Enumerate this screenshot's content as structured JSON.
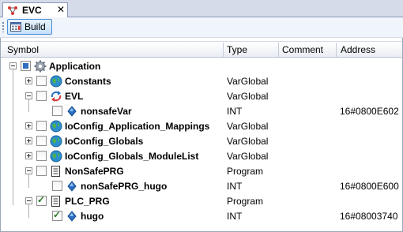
{
  "tab": {
    "title": "EVC",
    "close": "✕",
    "icon": "evc-icon"
  },
  "toolbar": {
    "build_label": "Build",
    "build_icon": "build-icon"
  },
  "columns": {
    "symbol": "Symbol",
    "type": "Type",
    "comment": "Comment",
    "address": "Address"
  },
  "rows": [
    {
      "name": "Application",
      "type": "",
      "address": "",
      "icon": "gear-icon",
      "checkbox": "partial",
      "expander": "minus"
    },
    {
      "name": "Constants",
      "type": "VarGlobal",
      "address": "",
      "icon": "globe-icon",
      "checkbox": "unchecked",
      "expander": "plus"
    },
    {
      "name": "EVL",
      "type": "VarGlobal",
      "address": "",
      "icon": "refresh-arrows-icon",
      "checkbox": "unchecked",
      "expander": "minus"
    },
    {
      "name": "nonsafeVar",
      "type": "INT",
      "address": "16#0800E602",
      "icon": "variable-diamond-icon",
      "checkbox": "unchecked",
      "expander": ""
    },
    {
      "name": "IoConfig_Application_Mappings",
      "type": "VarGlobal",
      "address": "",
      "icon": "globe-icon",
      "checkbox": "unchecked",
      "expander": "plus"
    },
    {
      "name": "IoConfig_Globals",
      "type": "VarGlobal",
      "address": "",
      "icon": "globe-icon",
      "checkbox": "unchecked",
      "expander": "plus"
    },
    {
      "name": "IoConfig_Globals_ModuleList",
      "type": "VarGlobal",
      "address": "",
      "icon": "globe-icon",
      "checkbox": "unchecked",
      "expander": "plus"
    },
    {
      "name": "NonSafePRG",
      "type": "Program",
      "address": "",
      "icon": "program-document-icon",
      "checkbox": "unchecked",
      "expander": "minus"
    },
    {
      "name": "nonSafePRG_hugo",
      "type": "INT",
      "address": "16#0800E600",
      "icon": "variable-diamond-icon",
      "checkbox": "unchecked",
      "expander": ""
    },
    {
      "name": "PLC_PRG",
      "type": "Program",
      "address": "",
      "icon": "program-document-icon",
      "checkbox": "checked",
      "expander": "minus"
    },
    {
      "name": "hugo",
      "type": "INT",
      "address": "16#08003740",
      "icon": "variable-diamond-icon",
      "checkbox": "checked",
      "expander": ""
    }
  ],
  "colors": {
    "accent": "#2f6fc1",
    "header_bg": "#e9edf3",
    "globe": "#2a8fcf"
  }
}
